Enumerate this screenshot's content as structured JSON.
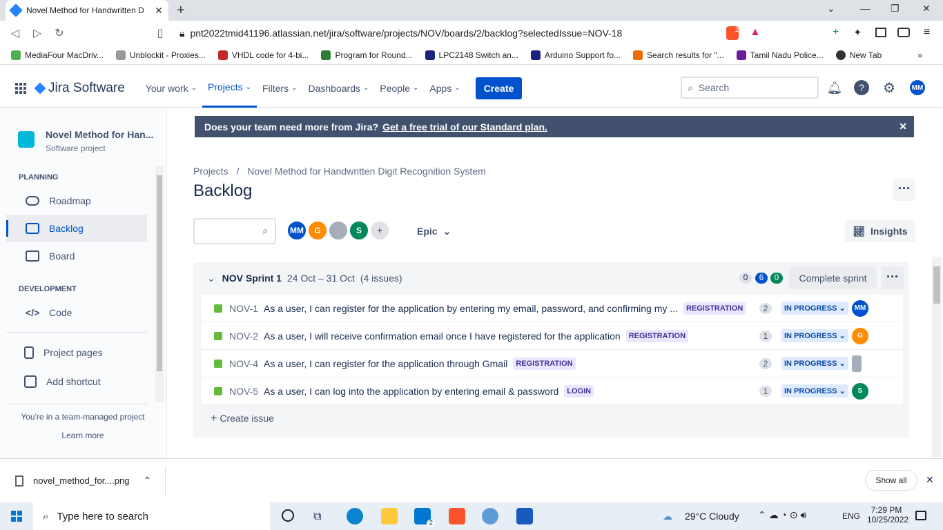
{
  "browser": {
    "tab_title": "Novel Method for Handwritten D",
    "url": "pnt2022tmid41196.atlassian.net/jira/software/projects/NOV/boards/2/backlog?selectedIssue=NOV-18",
    "bookmarks": [
      "MediaFour MacDriv...",
      "Unblockit - Proxies...",
      "VHDL code for 4-bi...",
      "Program for Round...",
      "LPC2148 Switch an...",
      "Arduino Support fo...",
      "Search results for \"...",
      "Tamil Nadu Police...",
      "New Tab"
    ],
    "extension_badge": "2"
  },
  "header": {
    "brand": "Jira Software",
    "menu": [
      "Your work",
      "Projects",
      "Filters",
      "Dashboards",
      "People",
      "Apps"
    ],
    "create": "Create",
    "search_placeholder": "Search",
    "user_initials": "MM"
  },
  "sidebar": {
    "project_name": "Novel Method for Han...",
    "project_type": "Software project",
    "planning_heading": "PLANNING",
    "planning_items": [
      "Roadmap",
      "Backlog",
      "Board"
    ],
    "development_heading": "DEVELOPMENT",
    "development_items": [
      "Code"
    ],
    "other_items": [
      "Project pages",
      "Add shortcut"
    ],
    "footer_text": "You're in a team-managed project",
    "footer_link": "Learn more"
  },
  "banner": {
    "text": "Does your team need more from Jira?",
    "link": "Get a free trial of our Standard plan."
  },
  "breadcrumb": {
    "root": "Projects",
    "sep": "/",
    "project": "Novel Method for Handwritten Digit Recognition System"
  },
  "page_title": "Backlog",
  "filters": {
    "avatars": [
      "MM",
      "G",
      "",
      "S"
    ],
    "epic": "Epic",
    "insights": "Insights"
  },
  "sprint": {
    "name": "NOV Sprint 1",
    "dates": "24 Oct – 31 Oct",
    "count": "(4 issues)",
    "badge_todo": "0",
    "badge_progress": "6",
    "badge_done": "0",
    "complete": "Complete sprint",
    "create_issue": "Create issue",
    "issues": [
      {
        "key": "NOV-1",
        "summary": "As a user, I can register for the application by entering my email, password, and confirming my ...",
        "label": "REGISTRATION",
        "points": "2",
        "status": "IN PROGRESS",
        "assignee": "MM"
      },
      {
        "key": "NOV-2",
        "summary": "As a user, I will receive confirmation email once I have registered for the application",
        "label": "REGISTRATION",
        "points": "1",
        "status": "IN PROGRESS",
        "assignee": "G"
      },
      {
        "key": "NOV-4",
        "summary": "As a user, I can register for the application through Gmail",
        "label": "REGISTRATION",
        "points": "2",
        "status": "IN PROGRESS",
        "assignee": ""
      },
      {
        "key": "NOV-5",
        "summary": "As a user, I can log into the application by entering email & password",
        "label": "LOGIN",
        "points": "1",
        "status": "IN PROGRESS",
        "assignee": "S"
      }
    ]
  },
  "downloads": {
    "file": "novel_method_for....png",
    "show_all": "Show all"
  },
  "taskbar": {
    "search_placeholder": "Type here to search",
    "mail_badge": "2",
    "weather": "29°C  Cloudy",
    "lang": "ENG",
    "time": "7:29 PM",
    "date": "10/25/2022"
  }
}
